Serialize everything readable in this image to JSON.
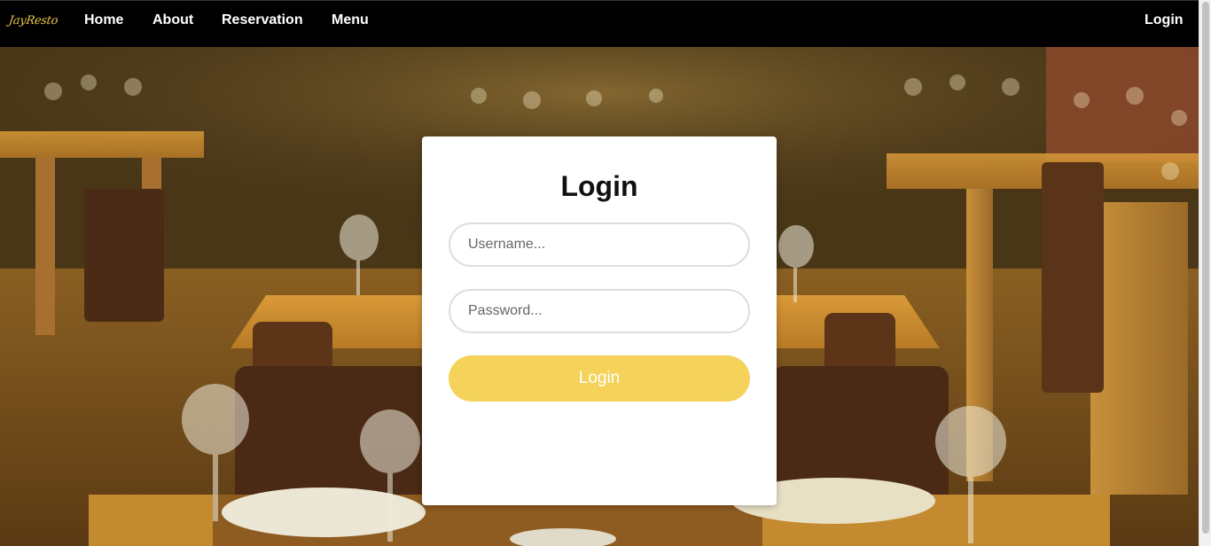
{
  "brand": {
    "logo_text": "JayResto",
    "logo_color": "#e8c547"
  },
  "nav": {
    "items": [
      {
        "label": "Home"
      },
      {
        "label": "About"
      },
      {
        "label": "Reservation"
      },
      {
        "label": "Menu"
      }
    ],
    "login_label": "Login"
  },
  "login_form": {
    "title": "Login",
    "username_placeholder": "Username...",
    "password_placeholder": "Password...",
    "submit_label": "Login",
    "button_color": "#f5d25a"
  },
  "background": {
    "subject": "restaurant-interior-photo"
  }
}
